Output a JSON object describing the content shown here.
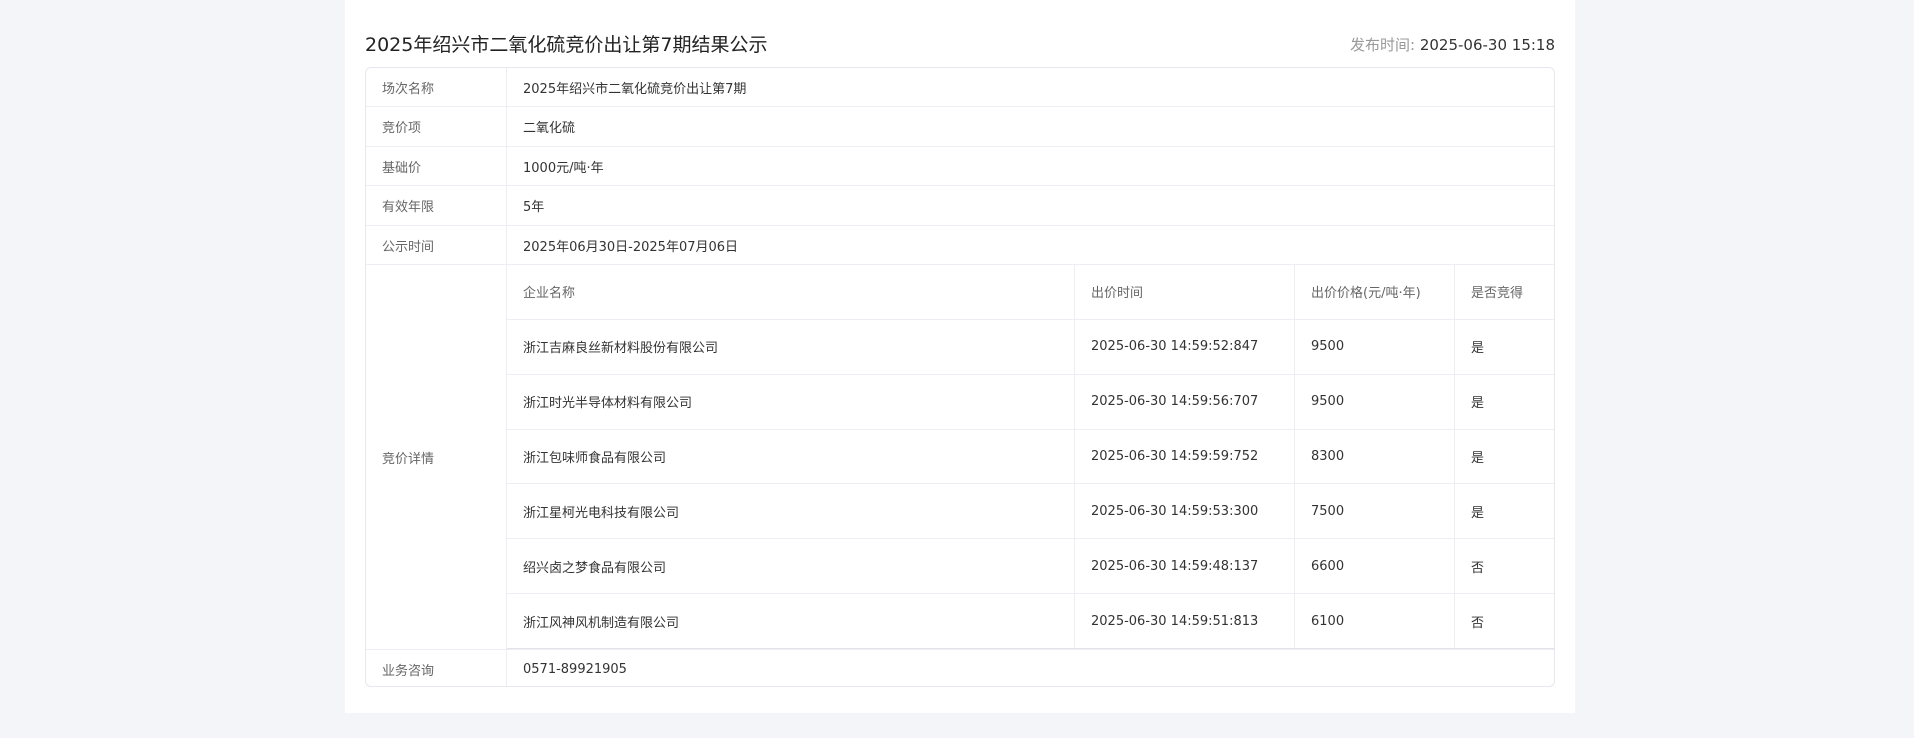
{
  "header": {
    "title": "2025年绍兴市二氧化硫竞价出让第7期结果公示",
    "publish_label": "发布时间:",
    "publish_time": "2025-06-30 15:18"
  },
  "info": {
    "session_label": "场次名称",
    "session_value": "2025年绍兴市二氧化硫竞价出让第7期",
    "item_label": "竞价项",
    "item_value": "二氧化硫",
    "base_price_label": "基础价",
    "base_price_value": "1000元/吨·年",
    "validity_label": "有效年限",
    "validity_value": "5年",
    "notice_label": "公示时间",
    "notice_value": "2025年06月30日-2025年07月06日",
    "detail_label": "竞价详情",
    "contact_label": "业务咨询",
    "contact_value": "0571-89921905"
  },
  "bids": {
    "columns": [
      "企业名称",
      "出价时间",
      "出价价格(元/吨·年)",
      "是否竞得"
    ],
    "rows": [
      {
        "company": "浙江吉麻良丝新材料股份有限公司",
        "time": "2025-06-30 14:59:52:847",
        "price": "9500",
        "won": "是"
      },
      {
        "company": "浙江时光半导体材料有限公司",
        "time": "2025-06-30 14:59:56:707",
        "price": "9500",
        "won": "是"
      },
      {
        "company": "浙江包味师食品有限公司",
        "time": "2025-06-30 14:59:59:752",
        "price": "8300",
        "won": "是"
      },
      {
        "company": "浙江星柯光电科技有限公司",
        "time": "2025-06-30 14:59:53:300",
        "price": "7500",
        "won": "是"
      },
      {
        "company": "绍兴卤之梦食品有限公司",
        "time": "2025-06-30 14:59:48:137",
        "price": "6600",
        "won": "否"
      },
      {
        "company": "浙江风神风机制造有限公司",
        "time": "2025-06-30 14:59:51:813",
        "price": "6100",
        "won": "否"
      }
    ]
  }
}
